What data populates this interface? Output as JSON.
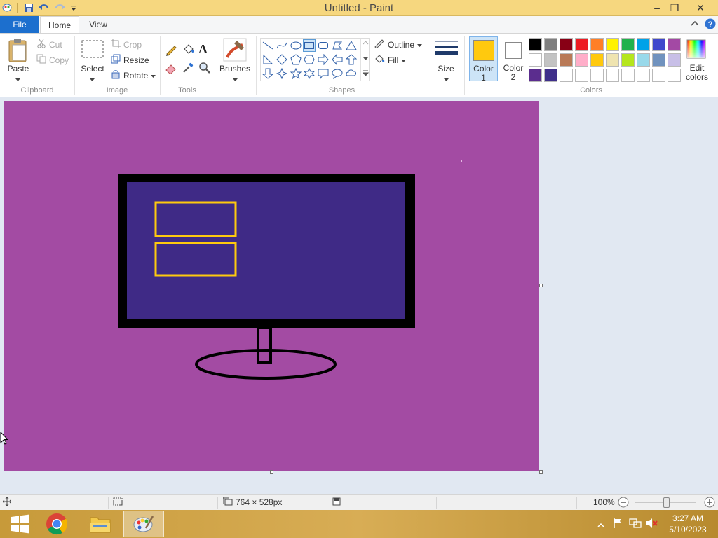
{
  "window": {
    "title": "Untitled - Paint",
    "minimize_glyph": "–",
    "restore_glyph": "❐",
    "close_glyph": "✕"
  },
  "tabs": {
    "file": "File",
    "home": "Home",
    "view": "View"
  },
  "clipboard": {
    "paste": "Paste",
    "cut": "Cut",
    "copy": "Copy",
    "group": "Clipboard"
  },
  "image": {
    "select": "Select",
    "crop": "Crop",
    "resize": "Resize",
    "rotate": "Rotate",
    "group": "Image"
  },
  "tools": {
    "group": "Tools",
    "text_glyph": "A"
  },
  "brushes": {
    "label": "Brushes"
  },
  "shapes": {
    "outline": "Outline",
    "fill": "Fill",
    "group": "Shapes"
  },
  "size": {
    "label": "Size"
  },
  "colors": {
    "color1_label": "Color",
    "color1_num": "1",
    "color2_label": "Color",
    "color2_num": "2",
    "edit_label": "Edit",
    "edit_label2": "colors",
    "group": "Colors",
    "color1": "#ffc90e",
    "color2": "#ffffff",
    "palette_row1": [
      "#000000",
      "#7f7f7f",
      "#880015",
      "#ed1c24",
      "#ff7f27",
      "#fff200",
      "#22b14c",
      "#00a2e8",
      "#3f48cc",
      "#a349a4"
    ],
    "palette_row2": [
      "#ffffff",
      "#c3c3c3",
      "#b97a57",
      "#ffaec9",
      "#ffc90e",
      "#efe4b0",
      "#b5e61d",
      "#99d9ea",
      "#7092be",
      "#c8bfe7"
    ],
    "palette_row3": [
      "#5b2d8e",
      "#3f2f8a",
      "#ffffff",
      "#ffffff",
      "#ffffff",
      "#ffffff",
      "#ffffff",
      "#ffffff",
      "#ffffff",
      "#ffffff"
    ]
  },
  "canvas": {
    "background": "#a34ba3",
    "monitor_screen": "#3f2a86",
    "monitor_frame": "#000000",
    "window_outline": "#ffc90e"
  },
  "status": {
    "dimensions": "764 × 528px",
    "zoom": "100%"
  },
  "taskbar": {
    "time": "3:27 AM",
    "date": "5/10/2023"
  }
}
